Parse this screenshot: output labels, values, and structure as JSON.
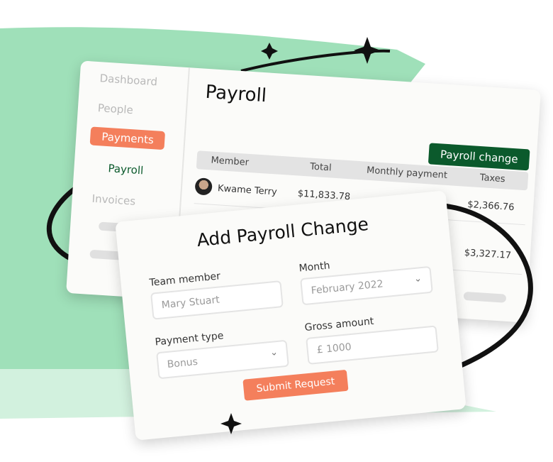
{
  "colors": {
    "accent": "#f47f5c",
    "brand_green": "#0b5a2c",
    "background_brush": "#9fe0b9"
  },
  "sidebar": {
    "items": [
      {
        "label": "Dashboard"
      },
      {
        "label": "People"
      },
      {
        "label": "Payments",
        "active": true
      },
      {
        "label": "Payroll",
        "sub": true
      },
      {
        "label": "Invoices"
      }
    ]
  },
  "main": {
    "title": "Payroll",
    "action_button": "Payroll change",
    "columns": [
      "Member",
      "Total",
      "Monthly payment",
      "Taxes"
    ],
    "rows": [
      {
        "member": "Kwame Terry",
        "total": "$11,833.78",
        "taxes": "$2,366.76"
      },
      {
        "taxes": "$3,327.17"
      }
    ]
  },
  "modal": {
    "title": "Add Payroll Change",
    "team_member": {
      "label": "Team member",
      "placeholder": "Mary Stuart"
    },
    "month": {
      "label": "Month",
      "value": "February 2022"
    },
    "payment_type": {
      "label": "Payment type",
      "value": "Bonus"
    },
    "gross_amount": {
      "label": "Gross amount",
      "placeholder": "£ 1000"
    },
    "submit": "Submit Request"
  }
}
